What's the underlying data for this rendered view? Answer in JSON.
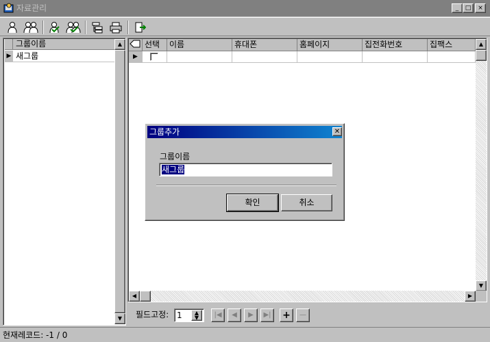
{
  "window": {
    "title": "자료관리",
    "minimize": "_",
    "maximize": "□",
    "close": "×"
  },
  "toolbar": {
    "tools": [
      {
        "icon": "person-icon"
      },
      {
        "icon": "people-icon"
      },
      {
        "icon": "person-check-icon"
      },
      {
        "icon": "people-check-icon"
      },
      {
        "icon": "tree-icon"
      },
      {
        "icon": "printer-icon"
      },
      {
        "icon": "exit-icon"
      }
    ]
  },
  "left_panel": {
    "header": "그룹이름",
    "items": [
      "새그룹"
    ]
  },
  "grid": {
    "columns": [
      "선택",
      "이름",
      "휴대폰",
      "홈페이지",
      "집전화번호",
      "집팩스"
    ],
    "row_indicator": "▶"
  },
  "navigator": {
    "field_fix_label": "필드고정:",
    "field_fix_value": "1",
    "buttons": [
      "|◀",
      "◀",
      "▶",
      "▶|",
      "+",
      "—"
    ]
  },
  "status": {
    "text": "현재레코드: -1 / 0"
  },
  "dialog": {
    "title": "그룹추가",
    "label": "그룹이름",
    "input_value": "새그룹",
    "ok": "확인",
    "cancel": "취소"
  }
}
